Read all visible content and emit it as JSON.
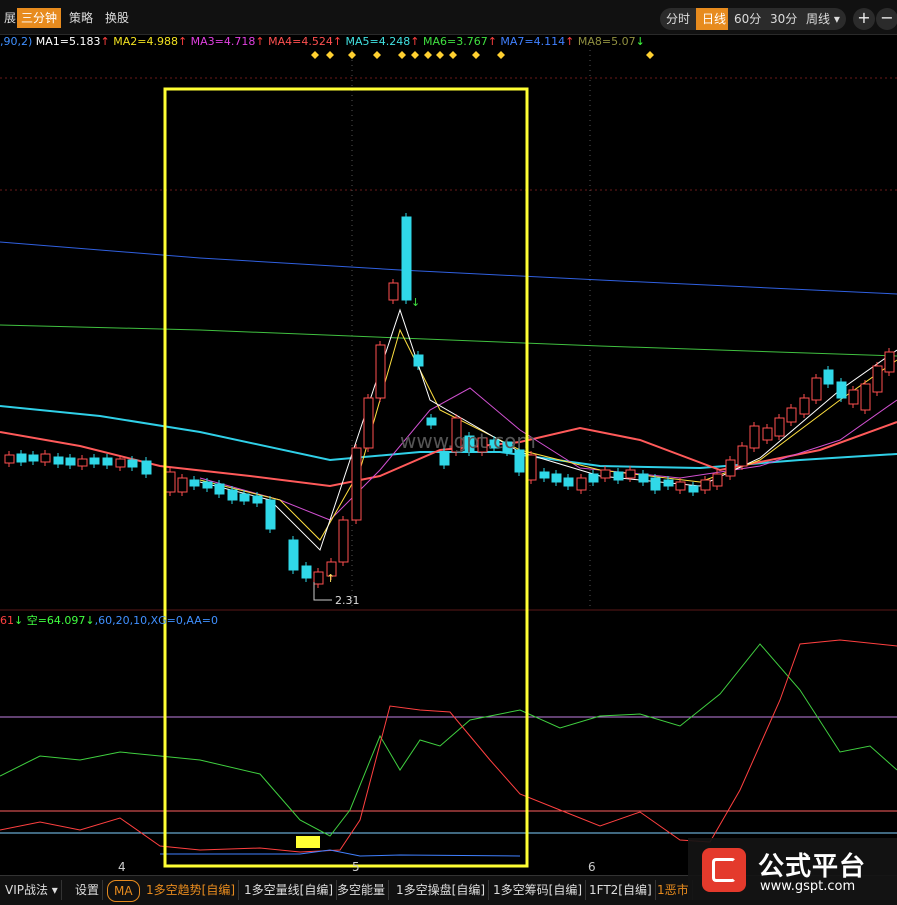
{
  "topbar": {
    "menu": [
      {
        "label": "展",
        "active": false
      },
      {
        "label": "三分钟",
        "active": true
      },
      {
        "label": "策略",
        "active": false
      },
      {
        "label": "换股",
        "active": false
      }
    ],
    "periods": [
      {
        "label": "分时",
        "active": false
      },
      {
        "label": "日线",
        "active": true
      },
      {
        "label": "60分",
        "active": false
      },
      {
        "label": "30分",
        "active": false
      },
      {
        "label": "周线 ▾",
        "active": false
      }
    ],
    "zoom_in": "+",
    "zoom_out": "−"
  },
  "ma_legend": {
    "prefix": ",90,2)",
    "items": [
      {
        "label": "MA1=5.183",
        "arrow": "↑",
        "color": "#ffffff"
      },
      {
        "label": "MA2=4.988",
        "arrow": "↑",
        "color": "#f0e020"
      },
      {
        "label": "MA3=4.718",
        "arrow": "↑",
        "color": "#e040e0"
      },
      {
        "label": "MA4=4.524",
        "arrow": "↑",
        "color": "#ff5050"
      },
      {
        "label": "MA5=4.248",
        "arrow": "↑",
        "color": "#40e0e0"
      },
      {
        "label": "MA6=3.767",
        "arrow": "↑",
        "color": "#40e040"
      },
      {
        "label": "MA7=4.114",
        "arrow": "↑",
        "color": "#4080ff"
      },
      {
        "label": "MA8=5.07",
        "arrow": "↓",
        "color": "#909040"
      }
    ]
  },
  "low_marker": "2.31",
  "chart_watermark": "www.gpt.com",
  "indicator_legend": {
    "items": [
      {
        "label": "61",
        "color": "#ff4040"
      },
      {
        "label": "↓ 空=64.097↓",
        "color": "#40ff40"
      },
      {
        "label": ",60,20,10,XG=0,AA=0",
        "color": "#4090ff"
      }
    ]
  },
  "x_labels": [
    "4",
    "5",
    "6"
  ],
  "bottom_tabs": [
    {
      "label": "VIP战法 ▾"
    },
    {
      "label": "设置"
    },
    {
      "label": "MA"
    },
    {
      "label": "1多空趋势[自编]"
    },
    {
      "label": "1多空量线[自编]"
    },
    {
      "label": "多空能量"
    },
    {
      "label": "1多空操盘[自编]"
    },
    {
      "label": "1多空筹码[自编]"
    },
    {
      "label": "1FT2[自编]"
    },
    {
      "label": "1恶市"
    }
  ],
  "watermark": {
    "name": "公式平台",
    "url": "www.gspt.com"
  },
  "colors": {
    "up": "#ff4040",
    "down": "#30d8e8",
    "highlight_box": "#ffff33",
    "accent": "#e78b1e"
  }
}
